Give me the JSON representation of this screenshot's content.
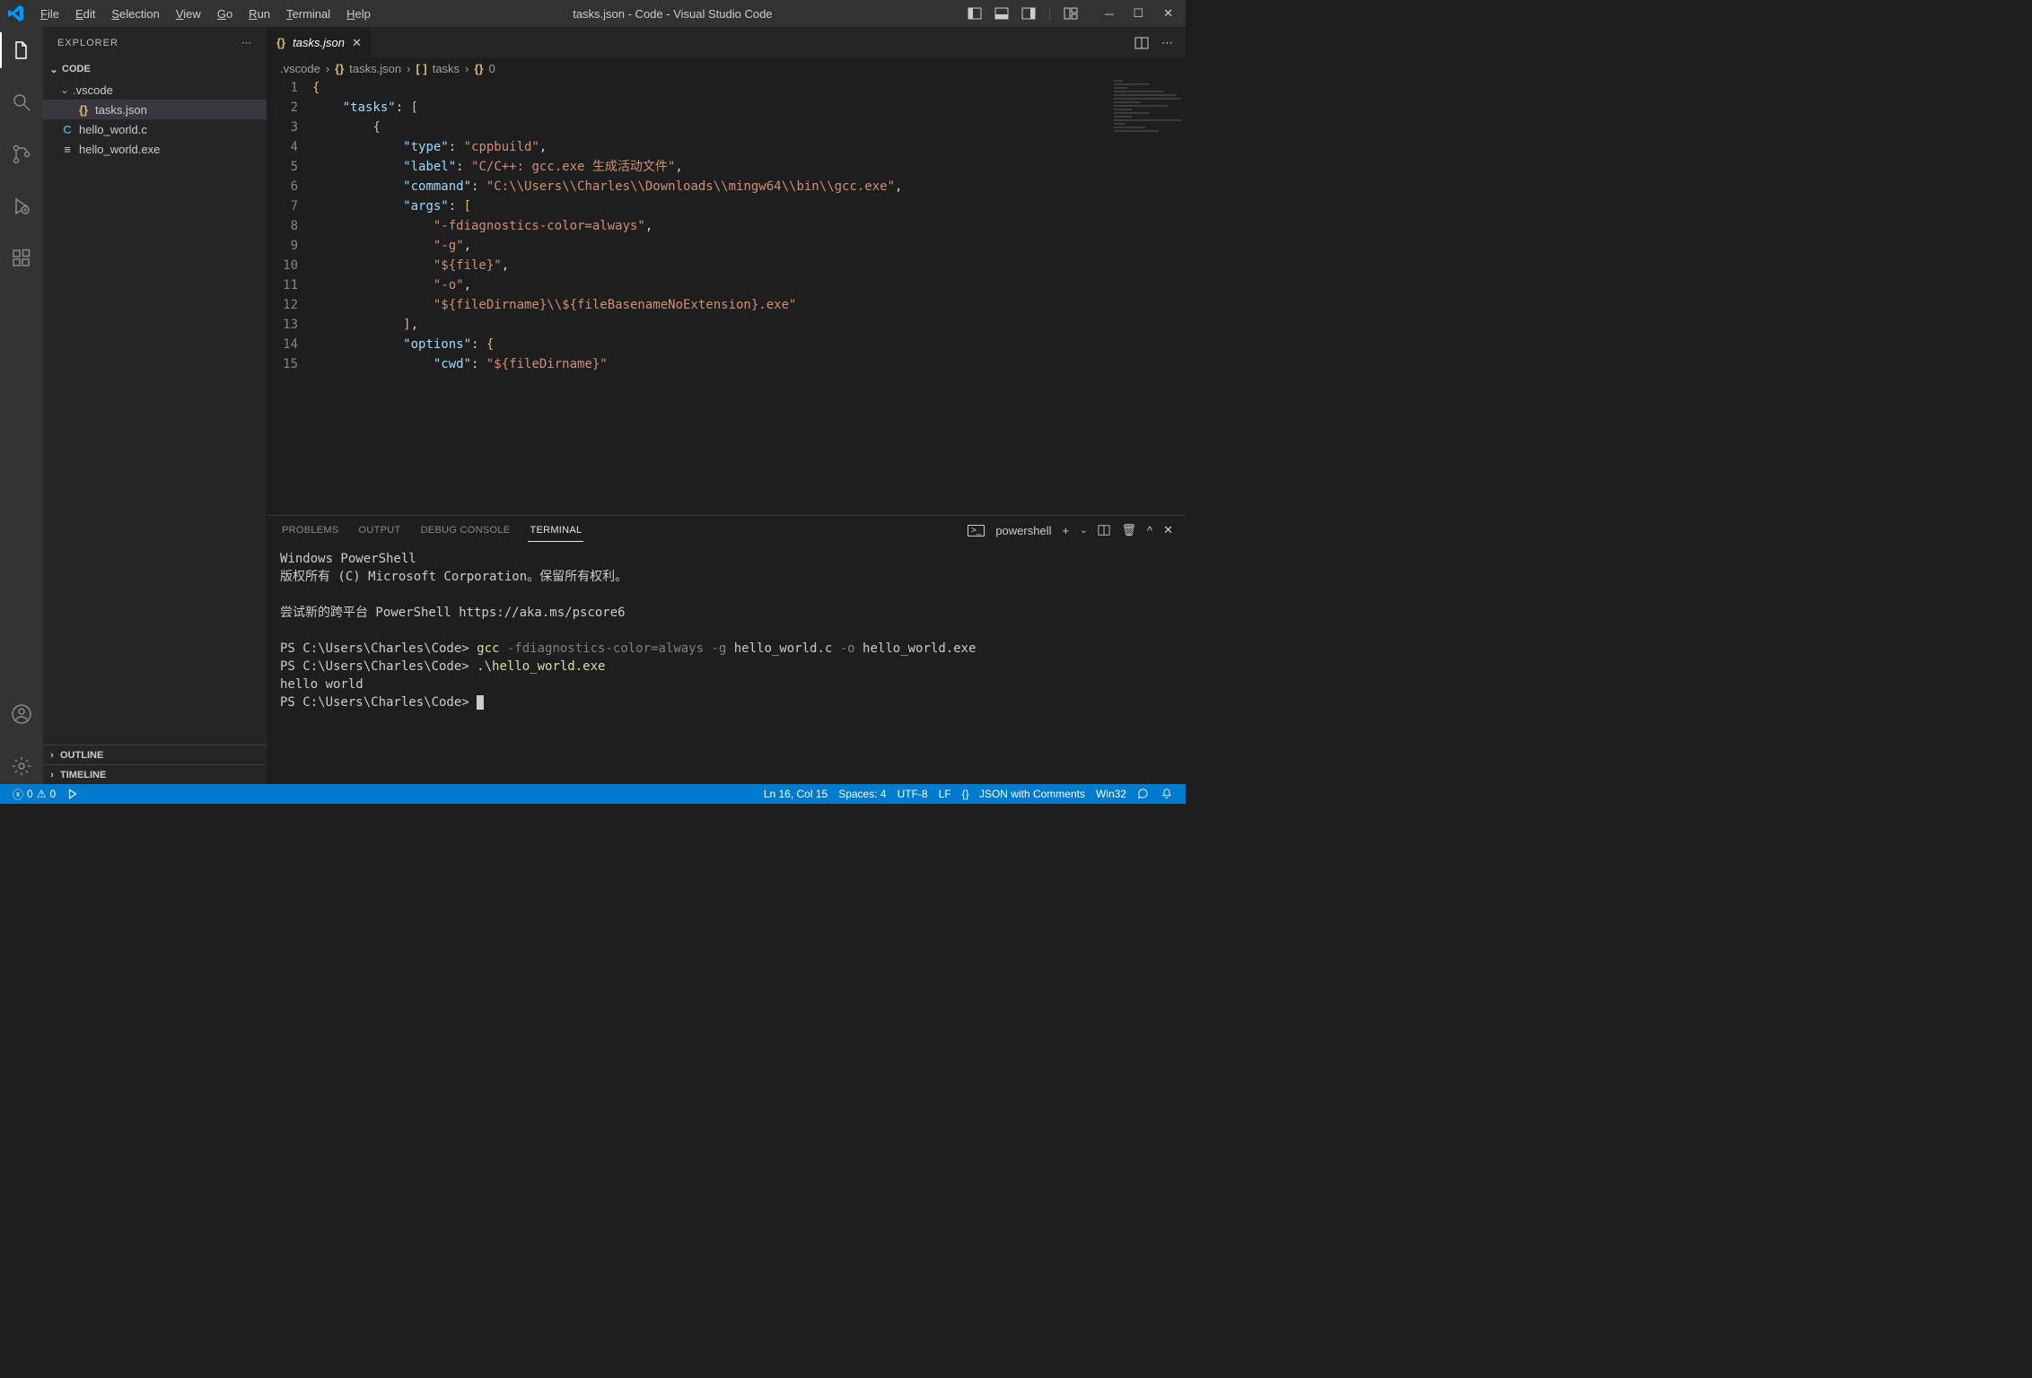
{
  "title": "tasks.json - Code - Visual Studio Code",
  "menu": [
    "File",
    "Edit",
    "Selection",
    "View",
    "Go",
    "Run",
    "Terminal",
    "Help"
  ],
  "explorer": {
    "title": "EXPLORER",
    "root": "CODE",
    "folder1": ".vscode",
    "file1": "tasks.json",
    "file2": "hello_world.c",
    "file3": "hello_world.exe",
    "outline": "OUTLINE",
    "timeline": "TIMELINE"
  },
  "tab": {
    "name": "tasks.json"
  },
  "breadcrumb": {
    "seg1": ".vscode",
    "seg2": "tasks.json",
    "seg3": "tasks",
    "seg4": "0"
  },
  "code": {
    "lines": [
      "1",
      "2",
      "3",
      "4",
      "5",
      "6",
      "7",
      "8",
      "9",
      "10",
      "11",
      "12",
      "13",
      "14",
      "15"
    ],
    "k_tasks": "\"tasks\"",
    "k_type": "\"type\"",
    "v_type": "\"cppbuild\"",
    "k_label": "\"label\"",
    "v_label": "\"C/C++: gcc.exe 生成活动文件\"",
    "k_command": "\"command\"",
    "v_command": "\"C:\\\\Users\\\\Charles\\\\Downloads\\\\mingw64\\\\bin\\\\gcc.exe\"",
    "k_args": "\"args\"",
    "a1": "\"-fdiagnostics-color=always\"",
    "a2": "\"-g\"",
    "a3": "\"${file}\"",
    "a4": "\"-o\"",
    "a5": "\"${fileDirname}\\\\${fileBasenameNoExtension}.exe\"",
    "k_options": "\"options\"",
    "k_cwd": "\"cwd\"",
    "v_cwd": "\"${fileDirname}\""
  },
  "panel": {
    "tabs": [
      "PROBLEMS",
      "OUTPUT",
      "DEBUG CONSOLE",
      "TERMINAL"
    ],
    "shell": "powershell"
  },
  "terminal": {
    "l1": "Windows PowerShell",
    "l2": "版权所有 (C) Microsoft Corporation。保留所有权利。",
    "l3": "尝试新的跨平台 PowerShell https://aka.ms/pscore6",
    "prompt": "PS C:\\Users\\Charles\\Code> ",
    "cmd1_a": "gcc",
    "cmd1_b": " -fdiagnostics-color=always -g ",
    "cmd1_c": "hello_world.c",
    "cmd1_d": " -o ",
    "cmd1_e": "hello_world.exe",
    "cmd2": ".\\hello_world.exe",
    "out1": "hello world"
  },
  "status": {
    "errors": "0",
    "warnings": "0",
    "lncol": "Ln 16, Col 15",
    "spaces": "Spaces: 4",
    "enc": "UTF-8",
    "eol": "LF",
    "lang": "JSON with Comments",
    "os": "Win32"
  }
}
